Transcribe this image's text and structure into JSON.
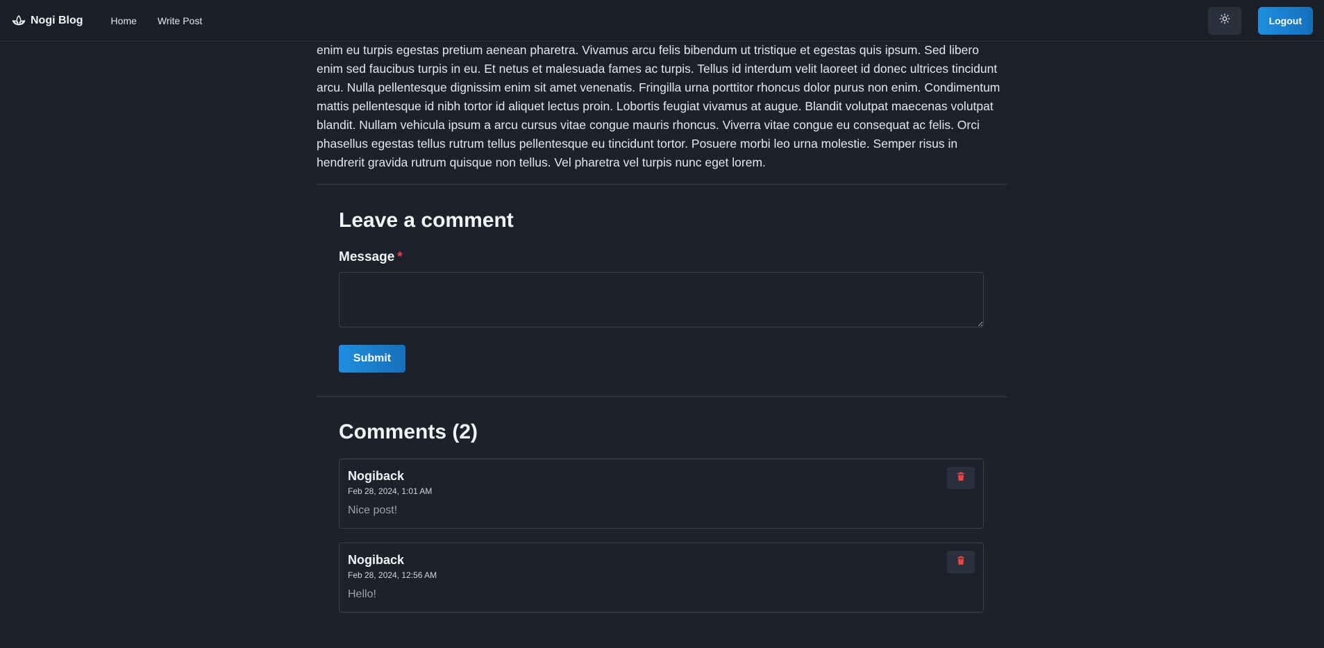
{
  "navbar": {
    "brand": "Nogi Blog",
    "links": [
      "Home",
      "Write Post"
    ],
    "theme_toggle_icon": "sun-icon",
    "logout_label": "Logout"
  },
  "post": {
    "body_text": "enim eu turpis egestas pretium aenean pharetra. Vivamus arcu felis bibendum ut tristique et egestas quis ipsum. Sed libero enim sed faucibus turpis in eu. Et netus et malesuada fames ac turpis. Tellus id interdum velit laoreet id donec ultrices tincidunt arcu. Nulla pellentesque dignissim enim sit amet venenatis. Fringilla urna porttitor rhoncus dolor purus non enim. Condimentum mattis pellentesque id nibh tortor id aliquet lectus proin. Lobortis feugiat vivamus at augue. Blandit volutpat maecenas volutpat blandit. Nullam vehicula ipsum a arcu cursus vitae congue mauris rhoncus. Viverra vitae congue eu consequat ac felis. Orci phasellus egestas tellus rutrum tellus pellentesque eu tincidunt tortor. Posuere morbi leo urna molestie. Semper risus in hendrerit gravida rutrum quisque non tellus. Vel pharetra vel turpis nunc eget lorem."
  },
  "comment_form": {
    "heading": "Leave a comment",
    "message_label": "Message",
    "required_mark": "*",
    "message_value": "",
    "submit_label": "Submit"
  },
  "comments": {
    "heading": "Comments (2)",
    "items": [
      {
        "author": "Nogiback",
        "date": "Feb 28, 2024, 1:01 AM",
        "text": "Nice post!"
      },
      {
        "author": "Nogiback",
        "date": "Feb 28, 2024, 12:56 AM",
        "text": "Hello!"
      }
    ]
  },
  "colors": {
    "background": "#1c212b",
    "accent": "#1f8ee0",
    "danger": "#ef4444"
  }
}
